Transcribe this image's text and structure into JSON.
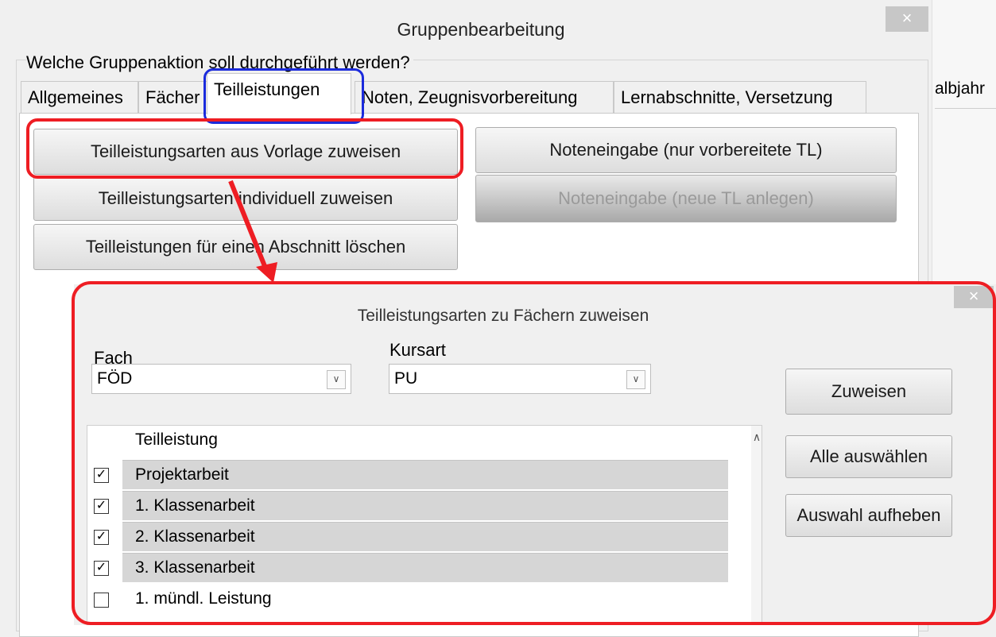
{
  "main_dialog": {
    "title": "Gruppenbearbeitung",
    "close_label": "×",
    "question": "Welche Gruppenaktion soll durchgeführt werden?",
    "tabs": [
      {
        "label": "Allgemeines"
      },
      {
        "label": "Fächer"
      },
      {
        "label": "Teilleistungen"
      },
      {
        "label": "Noten, Zeugnisvorbereitung"
      },
      {
        "label": "Lernabschnitte, Versetzung"
      }
    ],
    "background_tab_fragment": "albjahr",
    "buttons": {
      "assign_from_template": "Teilleistungsarten aus Vorlage zuweisen",
      "assign_individually": "Teilleistungsarten individuell zuweisen",
      "delete_for_section": "Teilleistungen für einen Abschnitt löschen",
      "grade_entry_prepared": "Noteneingabe (nur vorbereitete TL)",
      "grade_entry_new": "Noteneingabe (neue TL anlegen)"
    }
  },
  "sub_dialog": {
    "title": "Teilleistungsarten zu Fächern zuweisen",
    "close_label": "×",
    "fach": {
      "label": "Fach",
      "value": "FÖD"
    },
    "kursart": {
      "label": "Kursart",
      "value": "PU"
    },
    "assign_button": "Zuweisen",
    "select_all_button": "Alle auswählen",
    "clear_selection_button": "Auswahl aufheben",
    "list": {
      "header": "Teilleistung",
      "rows": [
        {
          "label": "Projektarbeit",
          "checked": true
        },
        {
          "label": "1. Klassenarbeit",
          "checked": true
        },
        {
          "label": "2. Klassenarbeit",
          "checked": true
        },
        {
          "label": "3. Klassenarbeit",
          "checked": true
        },
        {
          "label": "1. mündl. Leistung",
          "checked": false
        }
      ]
    }
  },
  "colors": {
    "highlight_red": "#ee1d23",
    "highlight_blue": "#1b2bdc",
    "selected_row": "#d6d6d6"
  }
}
